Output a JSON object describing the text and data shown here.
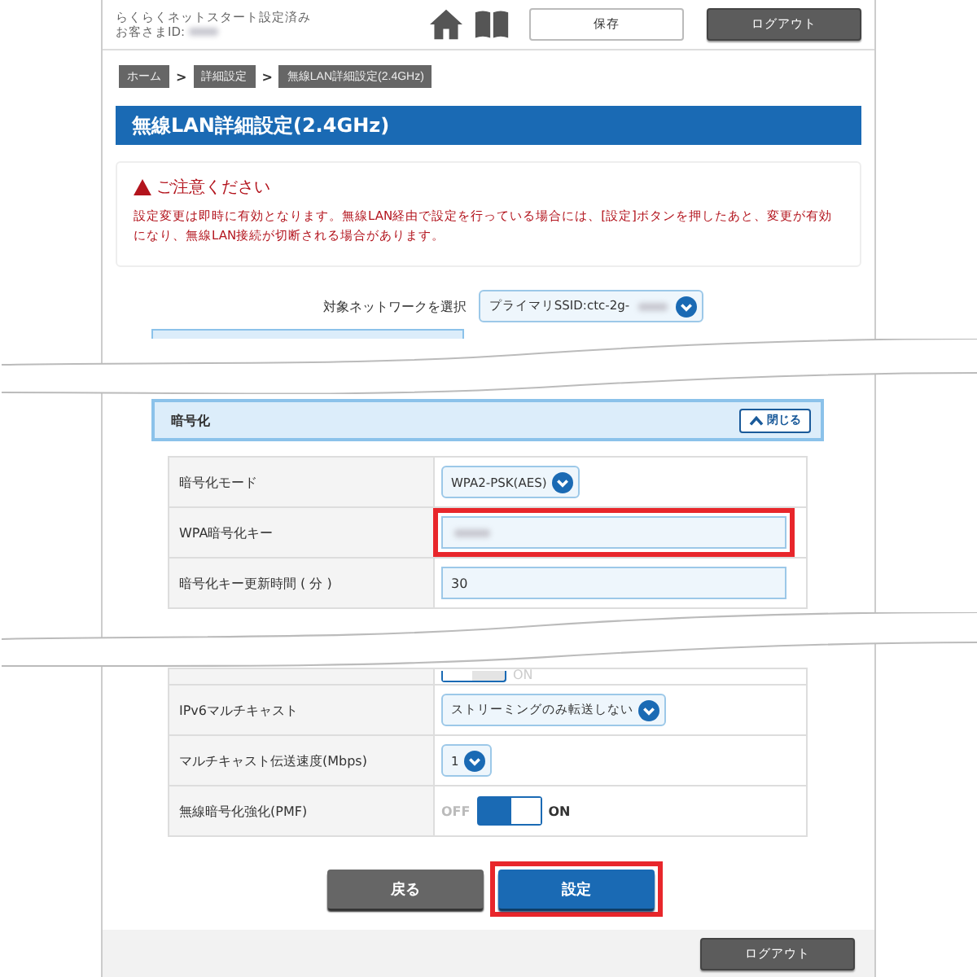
{
  "header": {
    "status": "らくらくネットスタート設定済み",
    "customer_id_label": "お客さまID:",
    "customer_id_redacted": true,
    "save_button": "保存",
    "logout_button": "ログアウト"
  },
  "breadcrumbs": [
    {
      "label": "ホーム"
    },
    {
      "separator": ">",
      "label": "詳細設定"
    },
    {
      "separator": ">",
      "label": "無線LAN詳細設定(2.4GHz)"
    }
  ],
  "page_title": "無線LAN詳細設定(2.4GHz)",
  "notice": {
    "title": "ご注意ください",
    "body": "設定変更は即時に有効となります。無線LAN経由で設定を行っている場合には、[設定]ボタンを押したあと、変更が有効になり、無線LAN接続が切断される場合があります。"
  },
  "network_select": {
    "label": "対象ネットワークを選択",
    "value": "プライマリSSID:ctc-2g-",
    "redacted": true
  },
  "encryption_section": {
    "title": "暗号化",
    "close_button": "閉じる",
    "expanded": true,
    "rows": [
      {
        "kind": "select",
        "label": "暗号化モード",
        "value": "WPA2-PSK(AES)"
      },
      {
        "kind": "input",
        "label": "WPA暗号化キー",
        "redacted": true,
        "highlighted": true
      },
      {
        "kind": "input",
        "label": "暗号化キー更新時間 ( 分 )",
        "value": "30",
        "highlighted": false
      }
    ]
  },
  "multicast_rows": [
    {
      "kind": "toggle",
      "on": false,
      "on_label": "ON"
    },
    {
      "kind": "select",
      "label": "IPv6マルチキャスト",
      "value": "ストリーミングのみ転送しない"
    },
    {
      "kind": "select",
      "label": "マルチキャスト伝送速度(Mbps)",
      "value": "1"
    },
    {
      "kind": "toggle",
      "label": "無線暗号化強化(PMF)",
      "on": true,
      "off_label": "OFF",
      "on_label": "ON"
    }
  ],
  "buttons": [
    {
      "kind": "back",
      "label": "戻る",
      "highlighted": false
    },
    {
      "kind": "submit",
      "label": "設定",
      "highlighted": true
    }
  ],
  "footer": {
    "logout_button": "ログアウト"
  }
}
